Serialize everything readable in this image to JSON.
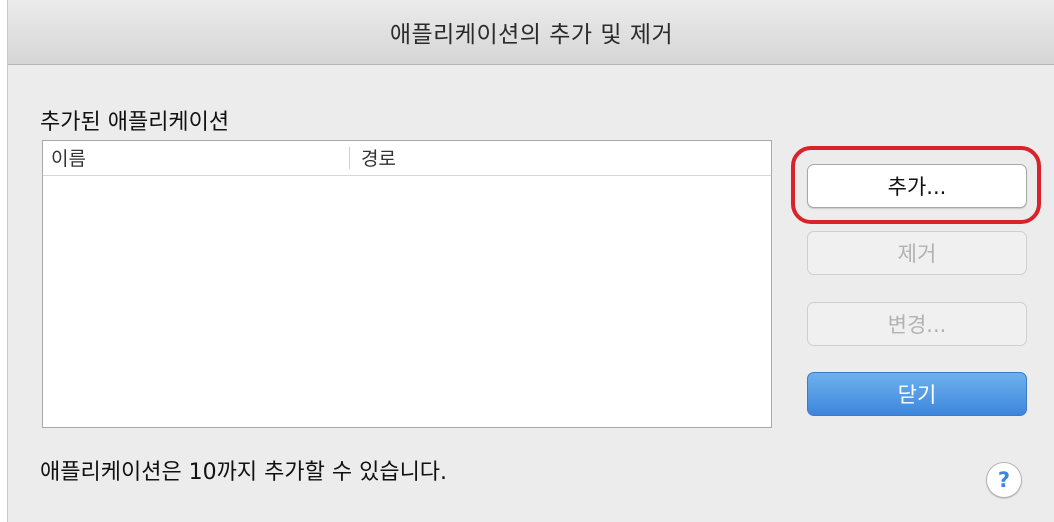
{
  "window": {
    "title": "애플리케이션의 추가 및 제거"
  },
  "list": {
    "heading": "추가된 애플리케이션",
    "columns": [
      "이름",
      "경로"
    ],
    "rows": []
  },
  "buttons": {
    "add": "추가...",
    "remove": "제거",
    "change": "변경...",
    "close": "닫기"
  },
  "footer": {
    "note": "애플리케이션은 10까지 추가할 수 있습니다.",
    "help_symbol": "?"
  },
  "colors": {
    "accent_blue": "#3d86dc",
    "highlight_red": "#d8232a"
  }
}
